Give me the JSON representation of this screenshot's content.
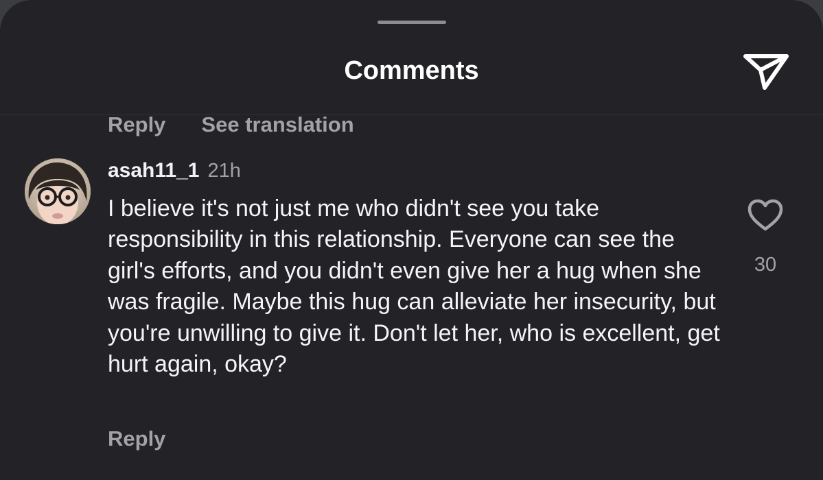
{
  "header": {
    "title": "Comments",
    "share_icon": "paper-plane-icon"
  },
  "previous_comment": {
    "reply_label": "Reply",
    "translate_label": "See translation"
  },
  "comment": {
    "avatar_icon": "user-avatar",
    "username": "asah11_1",
    "time": "21h",
    "text": "I believe it's not just me who didn't see you take responsibility in this relationship. Everyone can see the girl's efforts, and you didn't even give her a hug when she was fragile. Maybe this hug can alleviate her insecurity, but you're unwilling to give it. Don't let her, who is excellent, get hurt again, okay?",
    "like_icon": "heart-outline-icon",
    "like_count": "30",
    "reply_label": "Reply"
  },
  "colors": {
    "background": "#232327",
    "primary_text": "#f5f5f7",
    "secondary_text": "#a2a2a8",
    "handle": "#8c8c92"
  }
}
